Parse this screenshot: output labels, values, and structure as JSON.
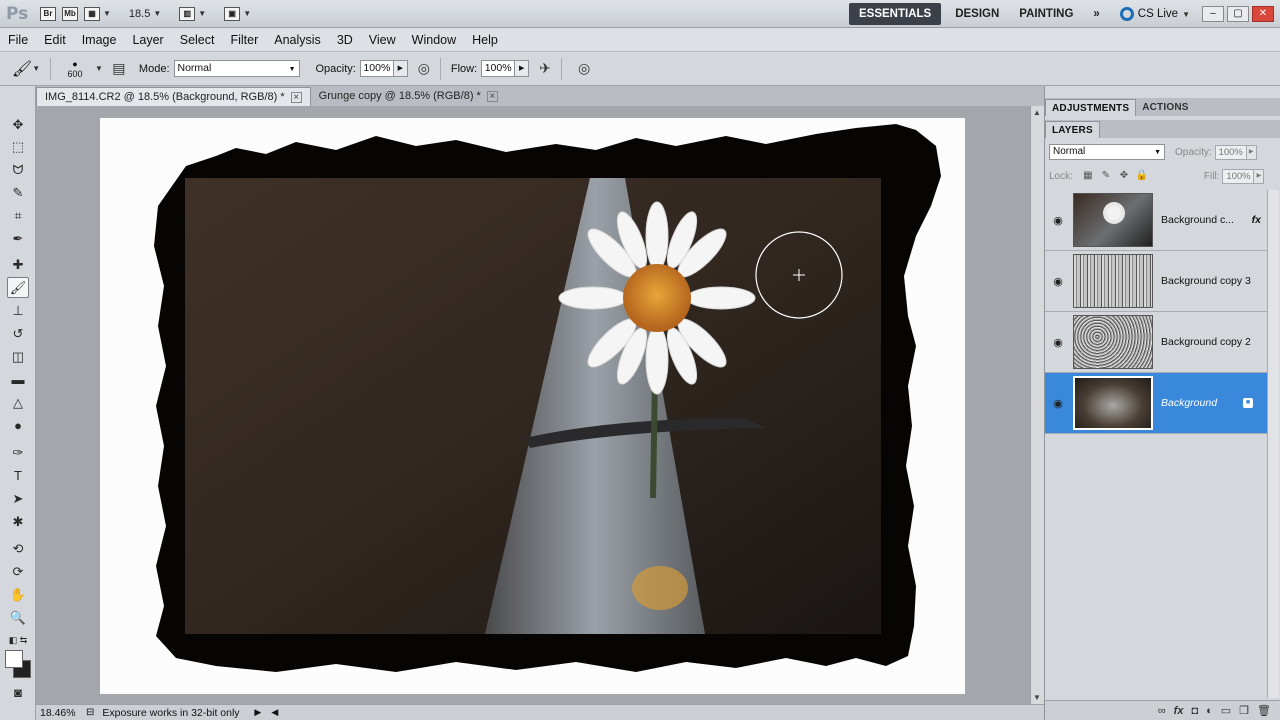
{
  "app": {
    "logo": "Ps",
    "bridge": "Br",
    "mini_bridge": "Mb",
    "zoom": "18.5",
    "workspaces": [
      "ESSENTIALS",
      "DESIGN",
      "PAINTING"
    ],
    "more": "»",
    "cs_live": "CS Live"
  },
  "menu": [
    "File",
    "Edit",
    "Image",
    "Layer",
    "Select",
    "Filter",
    "Analysis",
    "3D",
    "View",
    "Window",
    "Help"
  ],
  "options": {
    "brush_size": "600",
    "mode_label": "Mode:",
    "mode_value": "Normal",
    "opacity_label": "Opacity:",
    "opacity_value": "100%",
    "flow_label": "Flow:",
    "flow_value": "100%"
  },
  "tabs": [
    {
      "label": "IMG_8114.CR2 @ 18.5% (Background, RGB/8) *"
    },
    {
      "label": "Grunge copy @ 18.5% (RGB/8) *"
    }
  ],
  "status": {
    "zoom": "18.46%",
    "info": "Exposure works in 32-bit only"
  },
  "panels": {
    "top_tabs": [
      "ADJUSTMENTS",
      "ACTIONS"
    ],
    "layers_tab": "LAYERS",
    "blend_mode": "Normal",
    "opacity_label": "Opacity:",
    "opacity_value": "100%",
    "lock_label": "Lock:",
    "fill_label": "Fill:",
    "fill_value": "100%",
    "layers": [
      {
        "name": "Background c...",
        "fx": "fx"
      },
      {
        "name": "Background copy 3"
      },
      {
        "name": "Background copy 2"
      },
      {
        "name": "Background"
      }
    ]
  },
  "colors": {
    "accent": "#3a88dc",
    "workspace_active": "#3c4048"
  }
}
